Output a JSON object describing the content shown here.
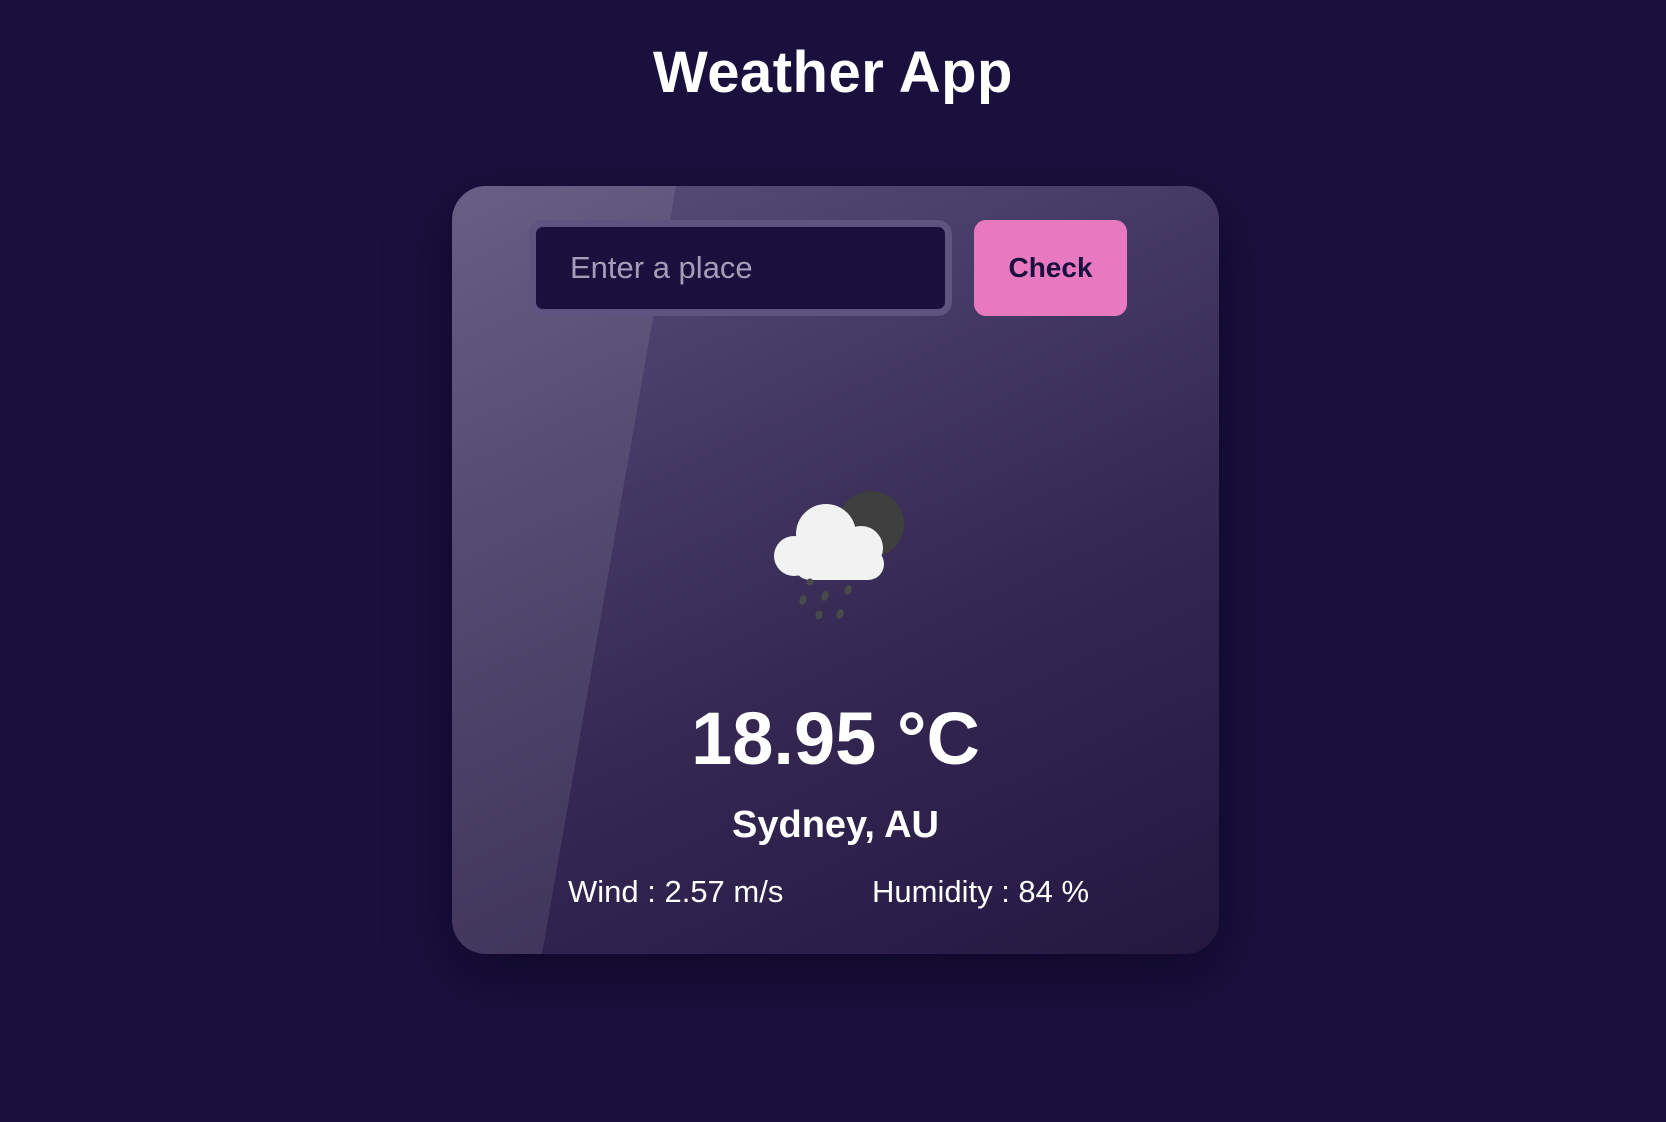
{
  "header": {
    "title": "Weather App"
  },
  "search": {
    "placeholder": "Enter a place",
    "value": "",
    "button_label": "Check"
  },
  "weather": {
    "icon": "cloud-rain-night-icon",
    "temperature": "18.95 °C",
    "location": "Sydney, AU",
    "wind": "Wind : 2.57 m/s",
    "humidity": "Humidity : 84 %"
  },
  "colors": {
    "background": "#1a103e",
    "accent_button": "#e879c0",
    "card_top": "#5a4f7a",
    "card_bottom": "#24183f",
    "text": "#ffffff"
  }
}
